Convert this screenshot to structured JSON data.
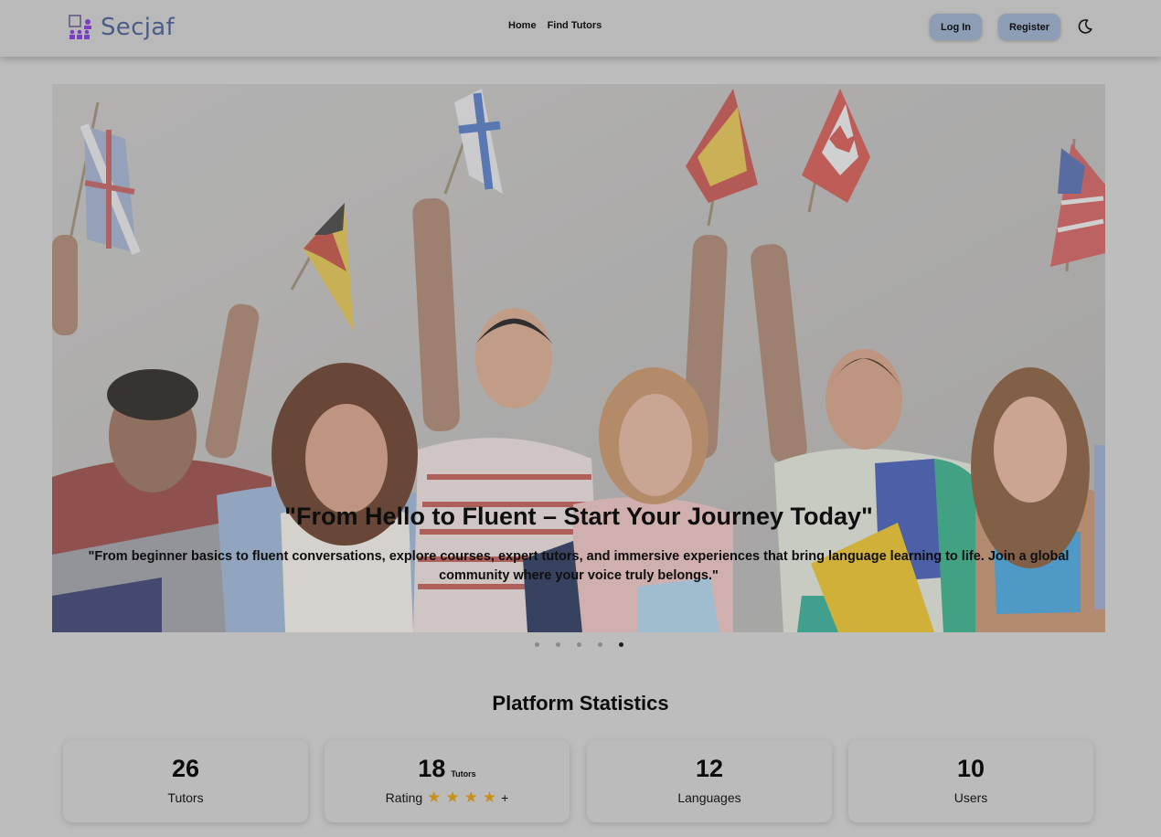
{
  "brand": {
    "name": "Secjaf"
  },
  "nav": {
    "home": "Home",
    "find_tutors": "Find Tutors"
  },
  "auth": {
    "login": "Log In",
    "register": "Register"
  },
  "hero": {
    "title": "\"From Hello to Fluent – Start Your Journey Today\"",
    "subtitle": "\"From beginner basics to fluent conversations, explore courses, expert tutors, and immersive experiences that bring language learning to life. Join a global community where your voice truly belongs.\"",
    "slides_count": 5,
    "active_slide": 5
  },
  "stats": {
    "title": "Platform Statistics",
    "cards": [
      {
        "value": "26",
        "label": "Tutors"
      },
      {
        "value": "18",
        "sup": "Tutors",
        "label": "Rating",
        "stars": 4,
        "suffix": "+"
      },
      {
        "value": "12",
        "label": "Languages"
      },
      {
        "value": "10",
        "label": "Users"
      }
    ]
  },
  "icons": {
    "theme": "moon-icon",
    "logo": "tutoring-logo-icon"
  },
  "colors": {
    "brand_text": "#4b5d86",
    "logo_accent": "#7a3fc2",
    "button": "#8e9db6",
    "star": "#c6901a"
  }
}
